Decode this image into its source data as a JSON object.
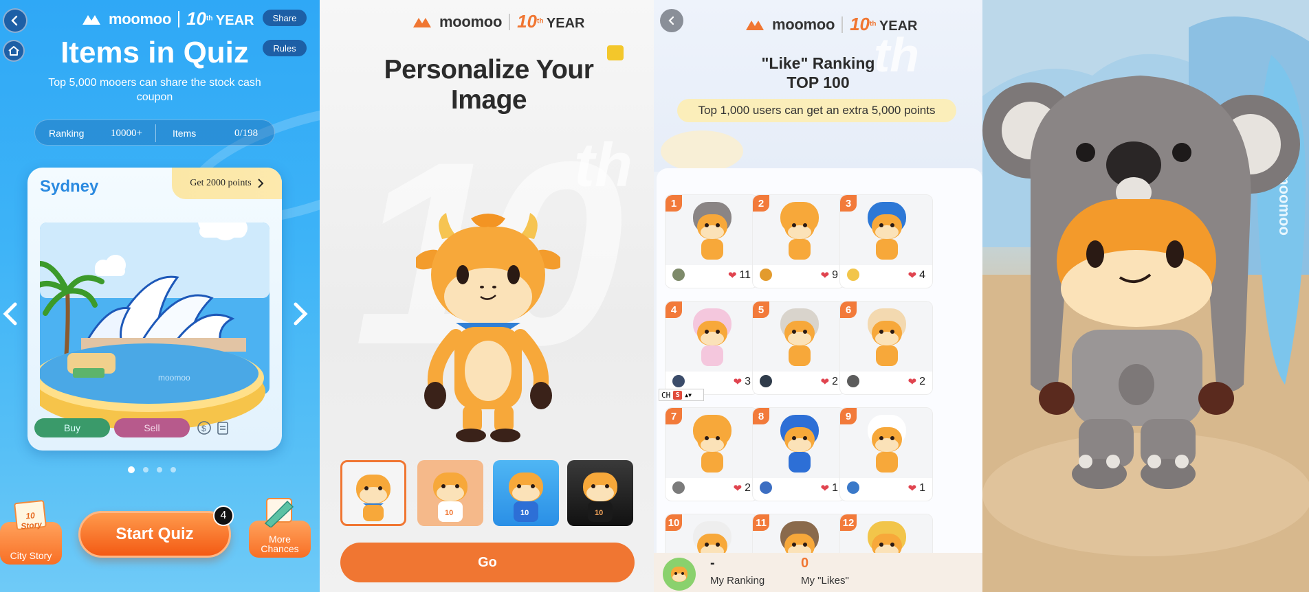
{
  "brand": {
    "name": "moomoo",
    "anniversary_number": "10",
    "anniversary_suffix": "th",
    "anniversary_word": "YEAR",
    "orange": "#f07632",
    "blue": "#2fa8f6"
  },
  "quiz_screen": {
    "back_icon": "chevron-left-icon",
    "home_icon": "home-icon",
    "share_label": "Share",
    "rules_label": "Rules",
    "title": "Items in Quiz",
    "subtitle": "Top 5,000 mooers can share the stock cash coupon",
    "stats": {
      "ranking_label": "Ranking",
      "ranking_value": "10000+",
      "items_label": "Items",
      "items_value": "0/198"
    },
    "city_card": {
      "city": "Sydney",
      "points_label": "Get 2000 points",
      "scene_watermark": "moomoo",
      "buy_label": "Buy",
      "sell_label": "Sell"
    },
    "carousel": {
      "total": 4,
      "active": 0
    },
    "city_story_tag": "10 Story",
    "city_story_label": "City Story",
    "start_label": "Start Quiz",
    "start_badge": "4",
    "more_chances_label": "More Chances"
  },
  "personalize_screen": {
    "bg_number": "10",
    "bg_suffix": "th",
    "title": "Personalize Your Image",
    "options": [
      {
        "name": "option-blue-scarf",
        "selected": true
      },
      {
        "name": "option-10th-shirt",
        "selected": false
      },
      {
        "name": "option-blue-shirt",
        "selected": false
      },
      {
        "name": "option-black-shirt",
        "selected": false
      }
    ],
    "shirt_print": "10",
    "go_label": "Go"
  },
  "ranking_screen": {
    "title_line1": "\"Like\" Ranking",
    "title_line2": "TOP 100",
    "promo": "Top 1,000 users can get an extra 5,000 points",
    "entries": [
      {
        "rank": "1",
        "likes": "11",
        "outfit": "koala"
      },
      {
        "rank": "2",
        "likes": "9",
        "outfit": "crown"
      },
      {
        "rank": "3",
        "likes": "4",
        "outfit": "helmet"
      },
      {
        "rank": "4",
        "likes": "3",
        "outfit": "pink"
      },
      {
        "rank": "5",
        "likes": "2",
        "outfit": "veil"
      },
      {
        "rank": "6",
        "likes": "2",
        "outfit": "hat"
      },
      {
        "rank": "7",
        "likes": "2",
        "outfit": "crown"
      },
      {
        "rank": "8",
        "likes": "1",
        "outfit": "blue"
      },
      {
        "rank": "9",
        "likes": "1",
        "outfit": "white"
      },
      {
        "rank": "10",
        "likes": "",
        "outfit": "horns"
      },
      {
        "rank": "11",
        "likes": "",
        "outfit": "bear"
      },
      {
        "rank": "12",
        "likes": "",
        "outfit": "headdress"
      }
    ],
    "ime_label": "CH",
    "ime_logo": "S",
    "my_ranking_value": "-",
    "my_ranking_label": "My Ranking",
    "my_likes_value": "0",
    "my_likes_label": "My \"Likes\""
  },
  "koala_screen": {
    "surfboard_text": "moomoo"
  }
}
